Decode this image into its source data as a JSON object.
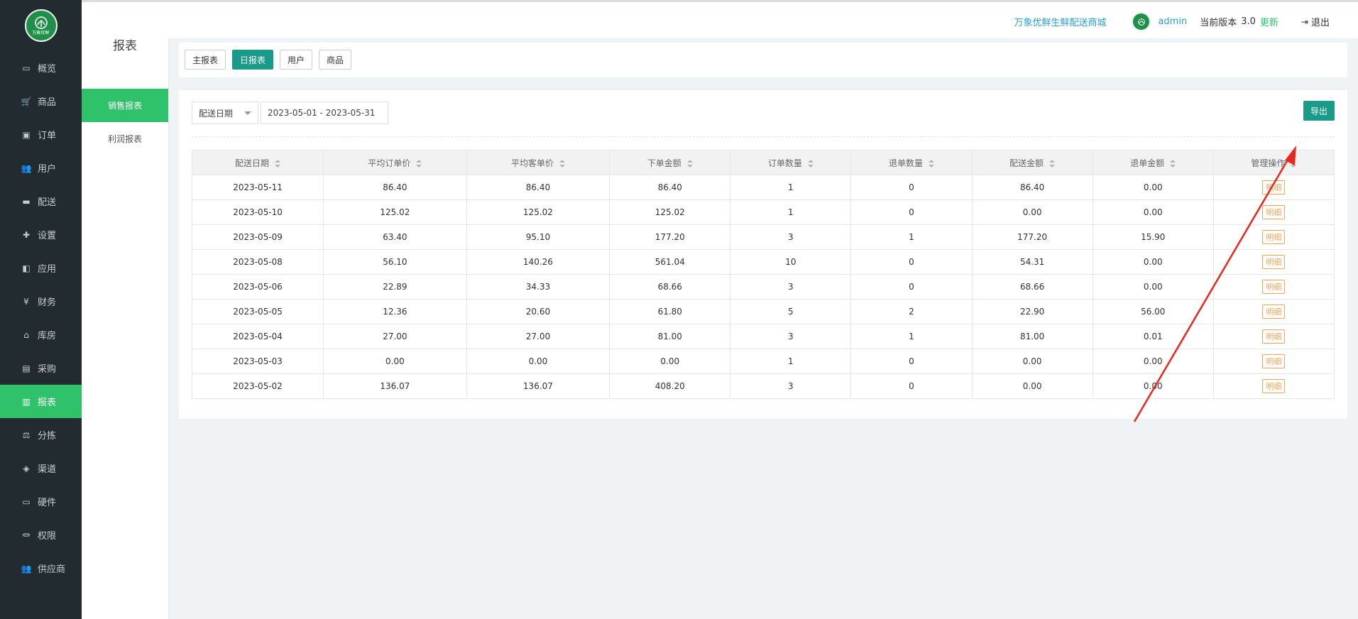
{
  "sidebar": {
    "logo_text": "万象优鲜",
    "items": [
      {
        "label": "概览",
        "icon": "monitor-icon"
      },
      {
        "label": "商品",
        "icon": "cart-icon"
      },
      {
        "label": "订单",
        "icon": "money-icon"
      },
      {
        "label": "用户",
        "icon": "users-icon"
      },
      {
        "label": "配送",
        "icon": "truck-icon"
      },
      {
        "label": "设置",
        "icon": "puzzle-icon"
      },
      {
        "label": "应用",
        "icon": "app-icon"
      },
      {
        "label": "财务",
        "icon": "yen-icon"
      },
      {
        "label": "库房",
        "icon": "home-icon"
      },
      {
        "label": "采购",
        "icon": "bus-icon"
      },
      {
        "label": "报表",
        "icon": "bar-chart-icon"
      },
      {
        "label": "分拣",
        "icon": "balance-icon"
      },
      {
        "label": "渠道",
        "icon": "cube-icon"
      },
      {
        "label": "硬件",
        "icon": "desktop-icon"
      },
      {
        "label": "权限",
        "icon": "bank-icon"
      },
      {
        "label": "供应商",
        "icon": "users-icon"
      }
    ],
    "active": "报表"
  },
  "subsidebar": {
    "title": "报表",
    "items": [
      "销售报表",
      "利润报表"
    ],
    "active": "销售报表"
  },
  "topbar": {
    "shop_name": "万象优鲜生鲜配送商城",
    "user": "admin",
    "version_label": "当前版本",
    "version": "3.0",
    "update": "更新",
    "logout": "退出"
  },
  "tabs": [
    "主报表",
    "日报表",
    "用户",
    "商品"
  ],
  "active_tab": "日报表",
  "filter": {
    "date_type": "配送日期",
    "date_range": "2023-05-01 - 2023-05-31"
  },
  "export_label": "导出",
  "table": {
    "headers": [
      "配送日期",
      "平均订单价",
      "平均客单价",
      "下单金额",
      "订单数量",
      "退单数量",
      "配送金额",
      "退单金额",
      "管理操作"
    ],
    "action_label": "明细",
    "rows": [
      [
        "2023-05-11",
        "86.40",
        "86.40",
        "86.40",
        "1",
        "0",
        "86.40",
        "0.00"
      ],
      [
        "2023-05-10",
        "125.02",
        "125.02",
        "125.02",
        "1",
        "0",
        "0.00",
        "0.00"
      ],
      [
        "2023-05-09",
        "63.40",
        "95.10",
        "177.20",
        "3",
        "1",
        "177.20",
        "15.90"
      ],
      [
        "2023-05-08",
        "56.10",
        "140.26",
        "561.04",
        "10",
        "0",
        "54.31",
        "0.00"
      ],
      [
        "2023-05-06",
        "22.89",
        "34.33",
        "68.66",
        "3",
        "0",
        "68.66",
        "0.00"
      ],
      [
        "2023-05-05",
        "12.36",
        "20.60",
        "61.80",
        "5",
        "2",
        "22.90",
        "56.00"
      ],
      [
        "2023-05-04",
        "27.00",
        "27.00",
        "81.00",
        "3",
        "1",
        "81.00",
        "0.01"
      ],
      [
        "2023-05-03",
        "0.00",
        "0.00",
        "0.00",
        "1",
        "0",
        "0.00",
        "0.00"
      ],
      [
        "2023-05-02",
        "136.07",
        "136.07",
        "408.20",
        "3",
        "0",
        "0.00",
        "0.00"
      ]
    ]
  },
  "colors": {
    "sidebar_bg": "#222b30",
    "active_green": "#2fc26a",
    "teal": "#1a9b8a",
    "link_blue": "#2a9fd6",
    "detail_orange": "#f5a35a",
    "annotation_red": "#e8281e"
  }
}
